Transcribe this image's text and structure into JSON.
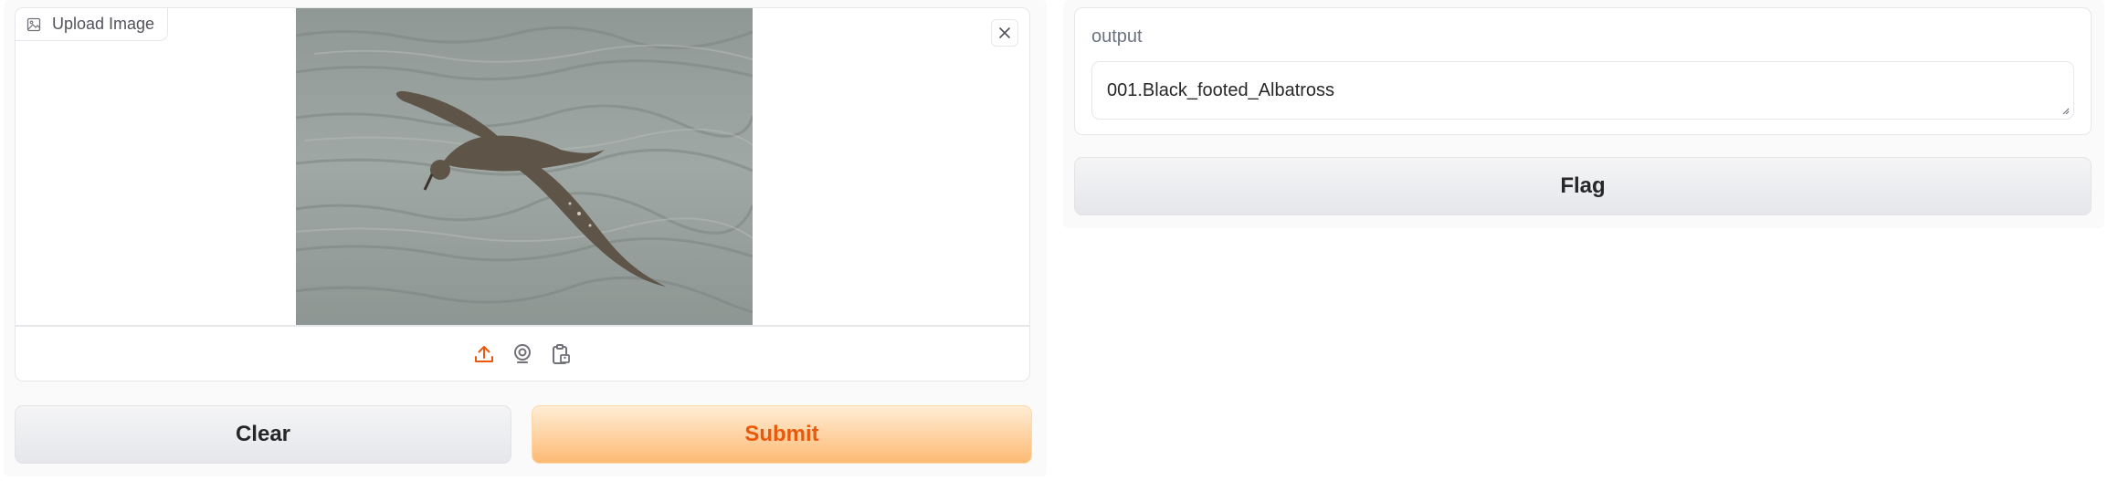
{
  "image_input": {
    "label": "Upload Image",
    "source_buttons": [
      "upload-icon",
      "webcam-icon",
      "clipboard-icon"
    ],
    "image_subject": "albatross in flight over gray sea"
  },
  "buttons": {
    "clear": "Clear",
    "submit": "Submit",
    "flag": "Flag"
  },
  "output": {
    "label": "output",
    "value": "001.Black_footed_Albatross"
  },
  "colors": {
    "accent": "#ea580c",
    "submit_bg": "#fdba74",
    "border": "#e5e7eb",
    "neutral_btn": "#e5e7eb"
  }
}
